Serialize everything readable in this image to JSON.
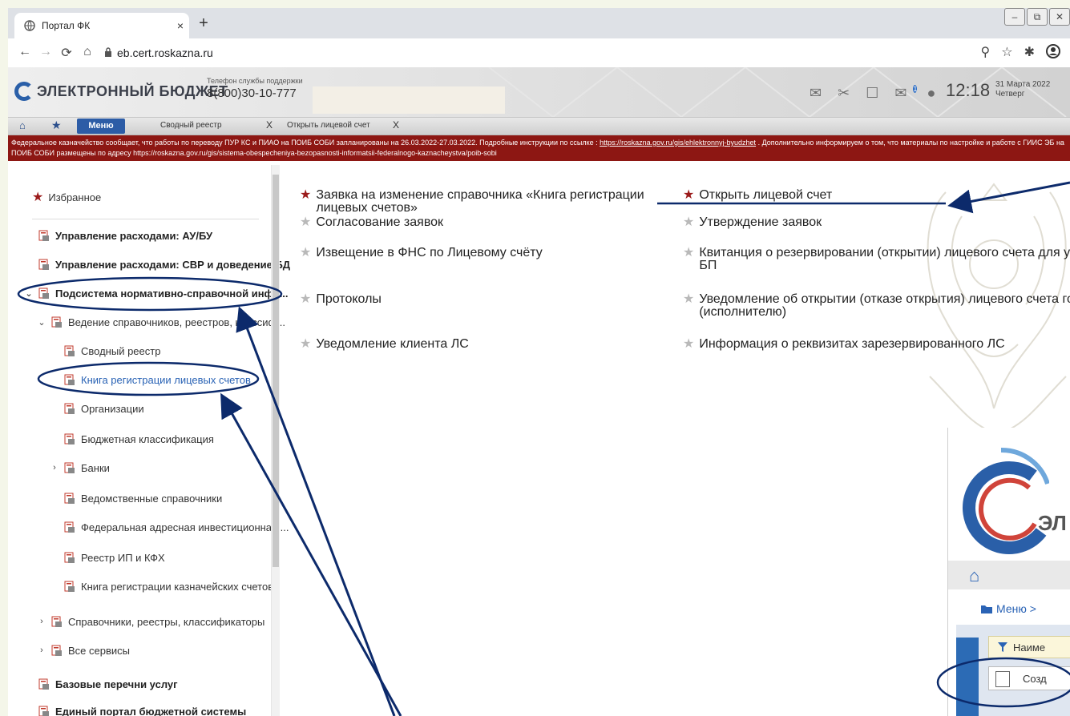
{
  "browser": {
    "tab_title": "Портал ФК",
    "tab_close": "×",
    "new_tab": "+",
    "url": "eb.cert.roskazna.ru",
    "window_controls": [
      "–",
      "⧉",
      "✕"
    ]
  },
  "header": {
    "brand": "ЭЛЕКТРОННЫЙ БЮДЖЕТ",
    "support_label": "Телефон службы поддержки",
    "support_phone": "8(800)30-10-777",
    "message_badge": "1",
    "time": "12:18",
    "date": "31 Марта 2022",
    "weekday": "Четверг"
  },
  "app_tabs": {
    "menu": "Меню",
    "tab1": "Сводный реестр",
    "tab2": "Открыть лицевой счет",
    "close": "X"
  },
  "notice": {
    "text1": "Федеральное казначейство сообщает, что работы по переводу ПУР КС и ПИАО на ПОИБ СОБИ запланированы на 26.03.2022-27.03.2022. Подробные инструкции по ссылке : ",
    "link": "https://roskazna.gov.ru/gis/ehlektronnyj-byudzhet",
    "text2": " . Дополнительно информируем о том, что материалы по настройке и работе с ГИИС ЭБ на ПОИБ СОБИ размещены по адресу https://roskazna.gov.ru/gis/sistema-obespecheniya-bezopasnosti-informatsii-federalnogo-kaznacheystva/poib-sobi"
  },
  "sidebar": {
    "favorites": "Избранное",
    "items": [
      {
        "label": "Управление расходами: АУ/БУ"
      },
      {
        "label": "Управление расходами: СВР и доведение БД"
      },
      {
        "label": "Подсистема нормативно-справочной инфо..."
      },
      {
        "label": "Ведение справочников, реестров, классиф..."
      },
      {
        "label": "Сводный реестр"
      },
      {
        "label": "Книга регистрации лицевых счетов"
      },
      {
        "label": "Организации"
      },
      {
        "label": "Бюджетная классификация"
      },
      {
        "label": "Банки"
      },
      {
        "label": "Ведомственные справочники"
      },
      {
        "label": "Федеральная адресная инвестиционная ..."
      },
      {
        "label": "Реестр ИП и КФХ"
      },
      {
        "label": "Книга регистрации казначейских счетов"
      },
      {
        "label": "Справочники, реестры, классификаторы"
      },
      {
        "label": "Все сервисы"
      },
      {
        "label": "Базовые перечни услуг"
      },
      {
        "label": "Единый портал бюджетной системы"
      }
    ]
  },
  "main": {
    "left": [
      {
        "label": "Заявка на изменение справочника «Книга регистрации лицевых счетов»",
        "favorite": true
      },
      {
        "label": "Согласование заявок",
        "favorite": false
      },
      {
        "label": "Извещение в ФНС по Лицевому счёту",
        "favorite": false
      },
      {
        "label": "Протоколы",
        "favorite": false
      },
      {
        "label": "Уведомление клиента ЛС",
        "favorite": false
      }
    ],
    "right": [
      {
        "label": "Открыть лицевой счет",
        "favorite": true
      },
      {
        "label": "Утверждение заявок",
        "favorite": false
      },
      {
        "line1": "Квитанция о резервировании (открытии) лицевого счета для учета операций неучастника",
        "line2": "БП",
        "favorite": false
      },
      {
        "line1": "Уведомление об открытии (отказе открытия) лицевого счета головному исполнителю",
        "line2": "(исполнителю)",
        "favorite": false
      },
      {
        "label": "Информация о реквизитах зарезервированного ЛС",
        "favorite": false
      }
    ]
  },
  "inset": {
    "logo_text": "ЭЛ",
    "menu_breadcrumb": "Меню >",
    "filter_row": "Наиме",
    "create_button": "Созд"
  },
  "colors": {
    "accent_blue": "#2c5ca6",
    "notice_red": "#8d1713",
    "favorite_star": "#9b1b1b",
    "annotation": "#0c2a6b"
  }
}
